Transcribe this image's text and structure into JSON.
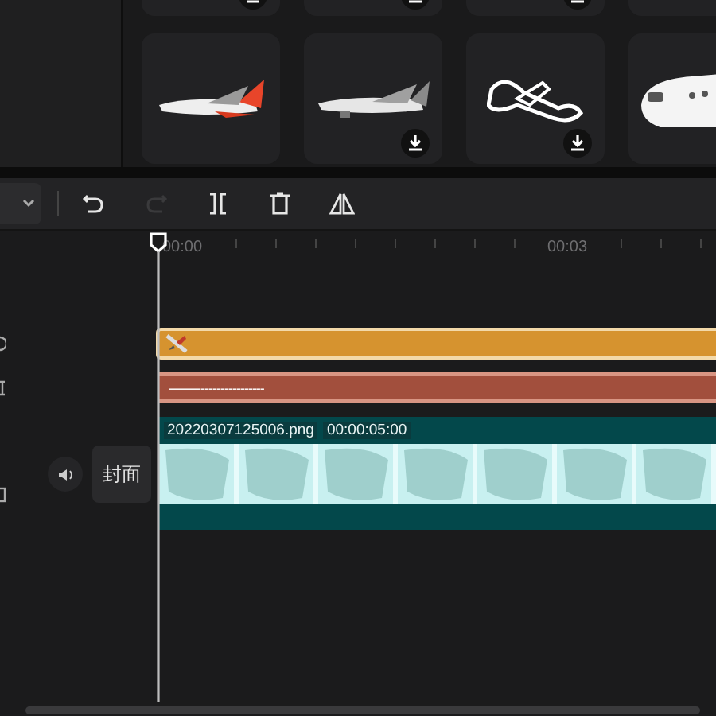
{
  "sticker_rows": [
    [
      {
        "downloadable": true
      },
      {
        "downloadable": true
      },
      {
        "downloadable": true
      },
      {
        "downloadable": false
      }
    ],
    [
      {
        "kind": "picture",
        "downloadable": false
      },
      {
        "kind": "picture",
        "downloadable": true
      },
      {
        "kind": "picture",
        "downloadable": true
      },
      {
        "kind": "picture",
        "downloadable": false
      }
    ]
  ],
  "toolbar": [
    {
      "kind": "undo",
      "disabled": false
    },
    {
      "kind": "redo",
      "disabled": true
    },
    {
      "kind": "split",
      "disabled": false
    },
    {
      "kind": "delete",
      "disabled": false
    },
    {
      "kind": "mirror",
      "disabled": false
    }
  ],
  "ruler": {
    "labels": [
      "00:00",
      "00:03"
    ]
  },
  "tracks": [
    {
      "kind": "sticker"
    },
    {
      "kind": "text",
      "text": "------------------------"
    },
    {
      "kind": "video",
      "file": "20220307125006.png",
      "duration": "00:00:05:00",
      "cover_label": "封面"
    }
  ]
}
